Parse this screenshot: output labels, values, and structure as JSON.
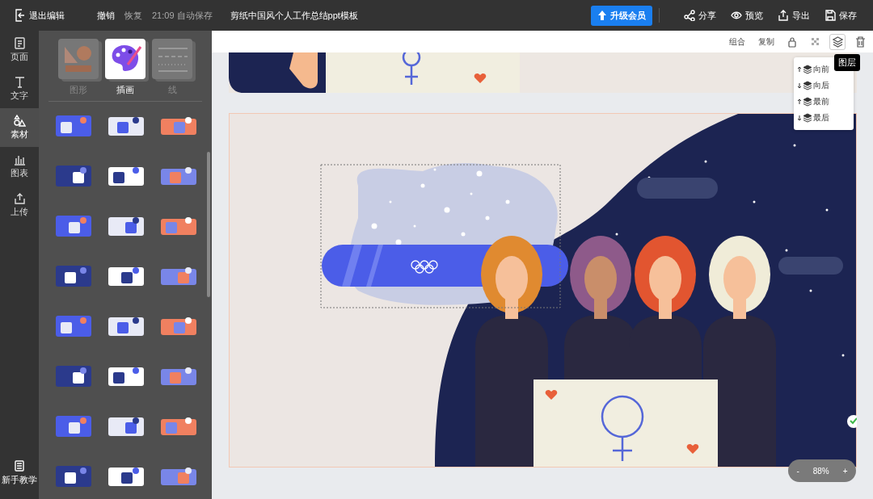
{
  "topbar": {
    "exit": "退出编辑",
    "undo": {
      "label": "撤销",
      "disabled": false
    },
    "redo": {
      "label": "恢复",
      "disabled": true
    },
    "autosave": "21:09 自动保存",
    "title": "剪纸中国风个人工作总结ppt模板",
    "upgrade": "升级会员",
    "actions": [
      {
        "kind": "share",
        "label": "分享"
      },
      {
        "kind": "preview",
        "label": "预览"
      },
      {
        "kind": "export",
        "label": "导出"
      },
      {
        "kind": "save",
        "label": "保存"
      }
    ]
  },
  "rail": {
    "items": [
      {
        "kind": "page",
        "label": "页面",
        "selected": false
      },
      {
        "kind": "text",
        "label": "文字",
        "selected": false
      },
      {
        "kind": "material",
        "label": "素材",
        "selected": true
      },
      {
        "kind": "chart",
        "label": "图表",
        "selected": false
      },
      {
        "kind": "upload",
        "label": "上传",
        "selected": false
      }
    ],
    "tutorial": "新手教学"
  },
  "panel": {
    "tabs": [
      {
        "kind": "shape",
        "label": "图形",
        "selected": false
      },
      {
        "kind": "illustration",
        "label": "插画",
        "selected": true
      },
      {
        "kind": "line",
        "label": "线",
        "selected": false
      }
    ]
  },
  "toolbar": {
    "group": "组合",
    "copy": "复制",
    "icons": [
      {
        "kind": "lock",
        "selected": false
      },
      {
        "kind": "opacity",
        "selected": false
      },
      {
        "kind": "layers",
        "selected": true
      },
      {
        "kind": "trash",
        "selected": false
      }
    ],
    "tooltip": "图层"
  },
  "layer_menu": [
    {
      "kind": "up",
      "label": "向前"
    },
    {
      "kind": "down",
      "label": "向后"
    },
    {
      "kind": "up",
      "label": "最前"
    },
    {
      "kind": "down",
      "label": "最后"
    }
  ],
  "zoom": {
    "minus": "-",
    "value": "88%",
    "plus": "+"
  }
}
